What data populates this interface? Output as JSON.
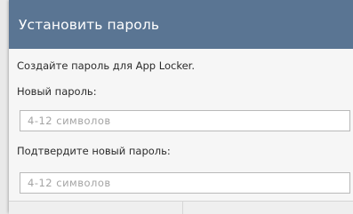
{
  "dialog": {
    "title": "Установить пароль",
    "description": "Создайте пароль для App Locker.",
    "new_password_label": "Новый пароль:",
    "new_password_placeholder": "4-12 символов",
    "new_password_value": "",
    "confirm_password_label": "Подтвердите новый пароль:",
    "confirm_password_placeholder": "4-12 символов",
    "confirm_password_value": ""
  },
  "colors": {
    "title_bar": "#5a7593",
    "dialog_background": "#f6f6f6"
  }
}
